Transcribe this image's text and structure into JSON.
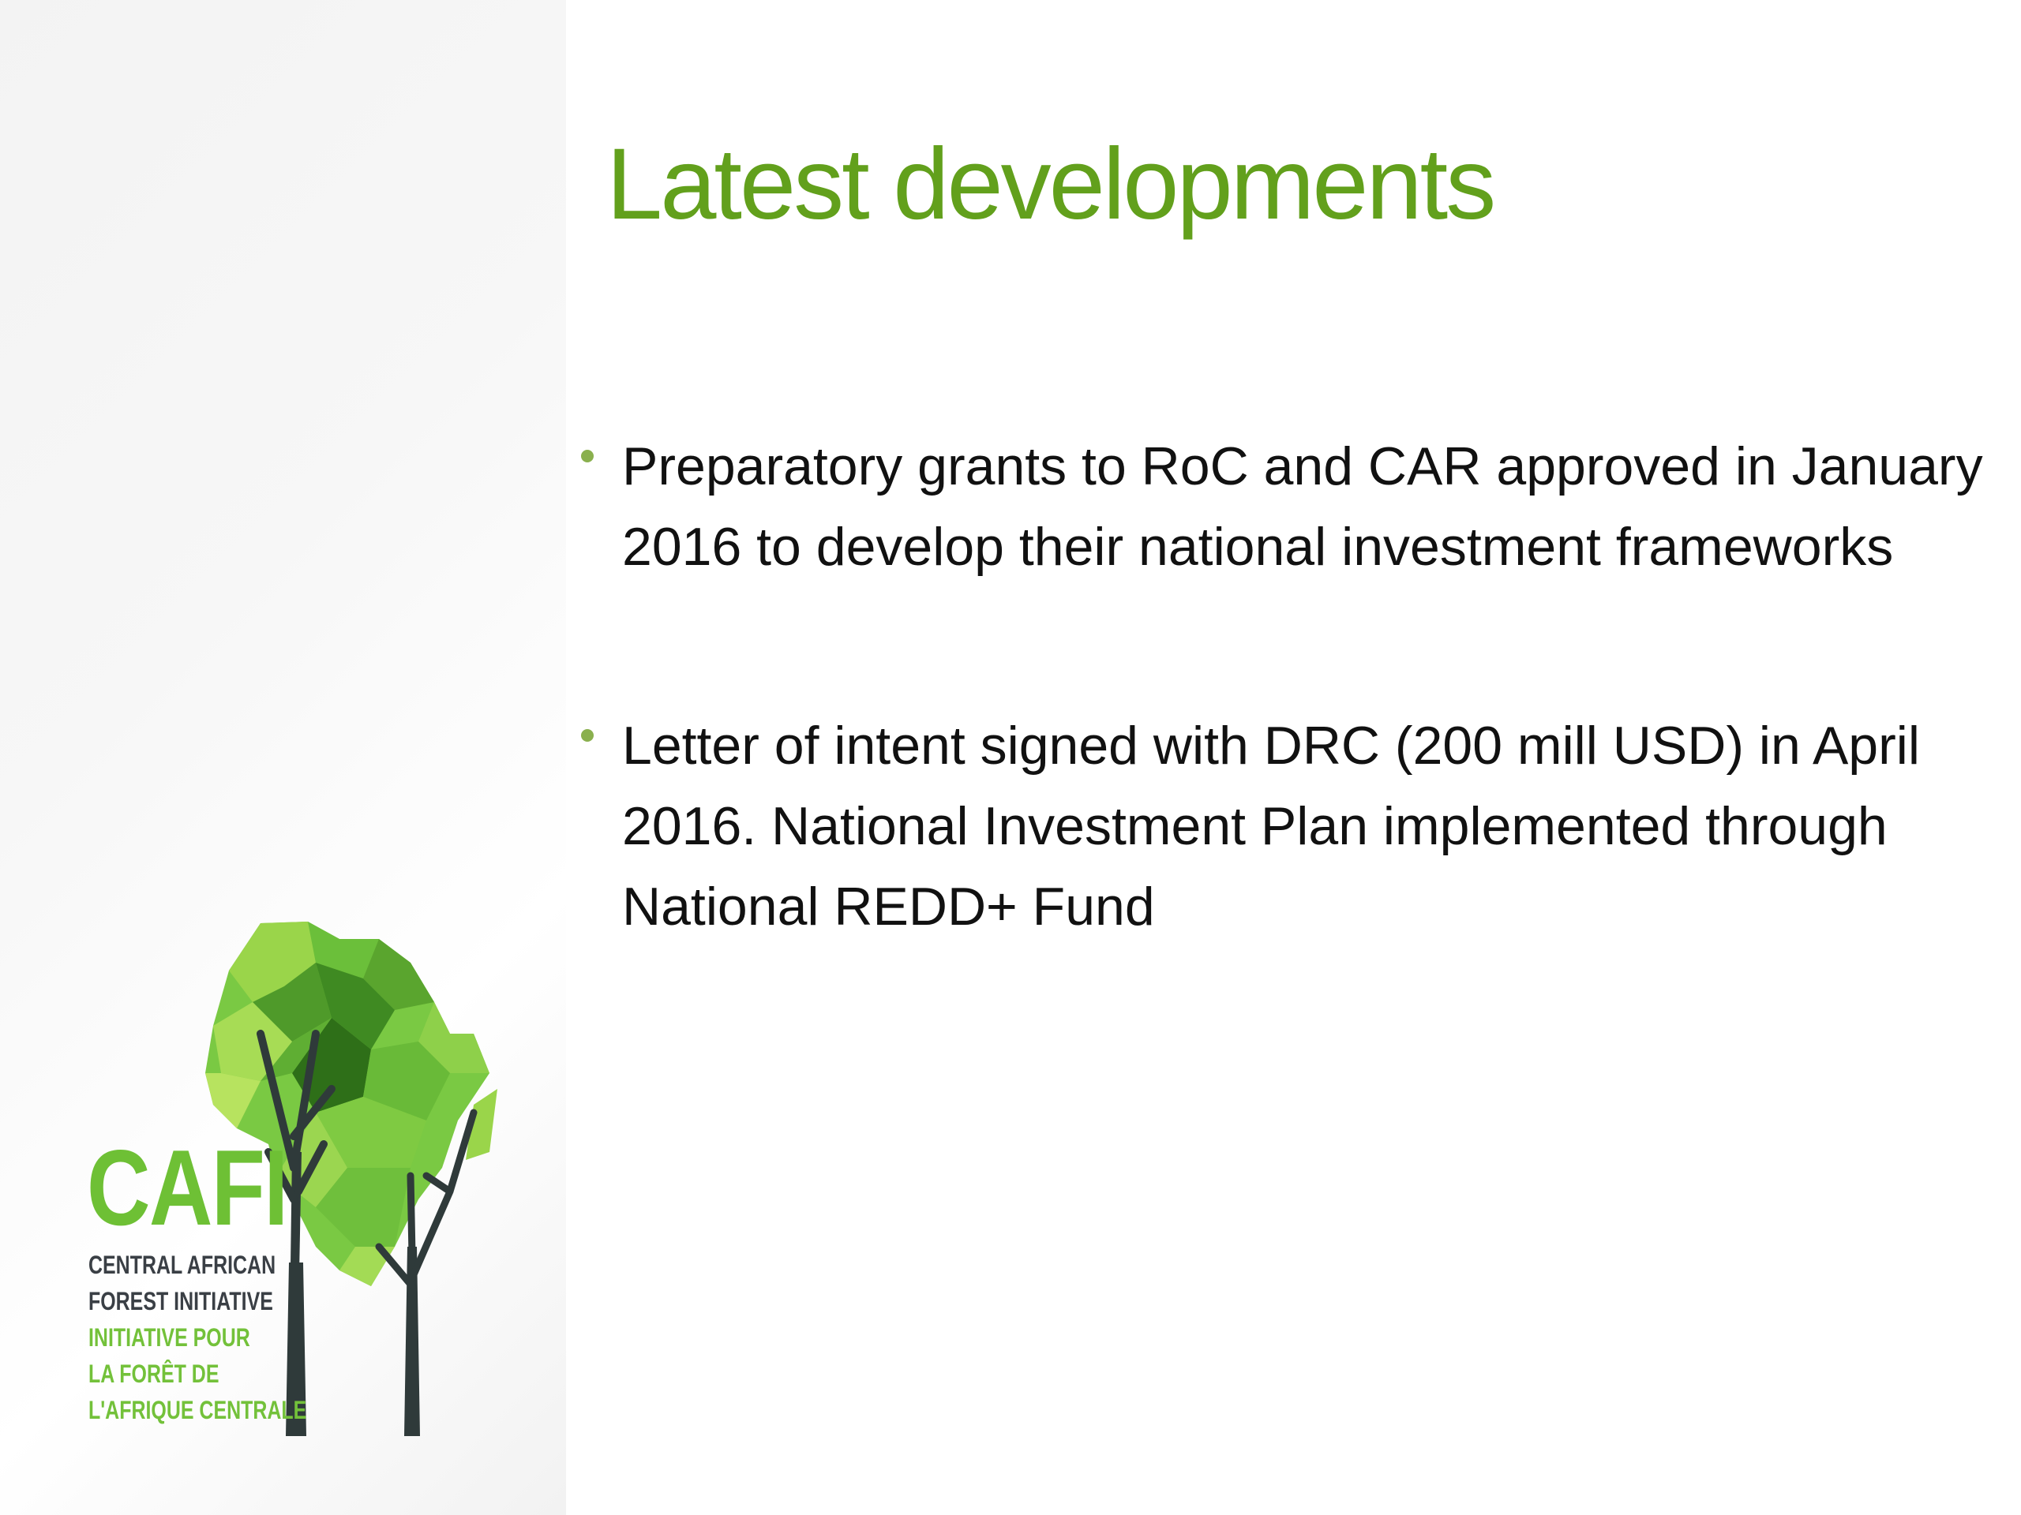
{
  "slide": {
    "title": "Latest developments",
    "bullets": [
      "Preparatory grants to RoC and CAR approved in January 2016 to develop their national investment frameworks",
      "Letter of intent signed with DRC (200 mill USD) in April 2016. National Investment Plan implemented through National REDD+ Fund"
    ]
  },
  "logo": {
    "name": "CAFI",
    "lines": [
      "CENTRAL AFRICAN",
      "FOREST INITIATIVE",
      "INITIATIVE  POUR",
      "LA FORÊT DE",
      "L'AFRIQUE CENTRALE"
    ]
  },
  "colors": {
    "title": "#62a01c",
    "bullet_marker": "#8ab04e",
    "body_text": "#111111",
    "logo_green": "#6ec035",
    "logo_dark": "#3a3f45"
  }
}
